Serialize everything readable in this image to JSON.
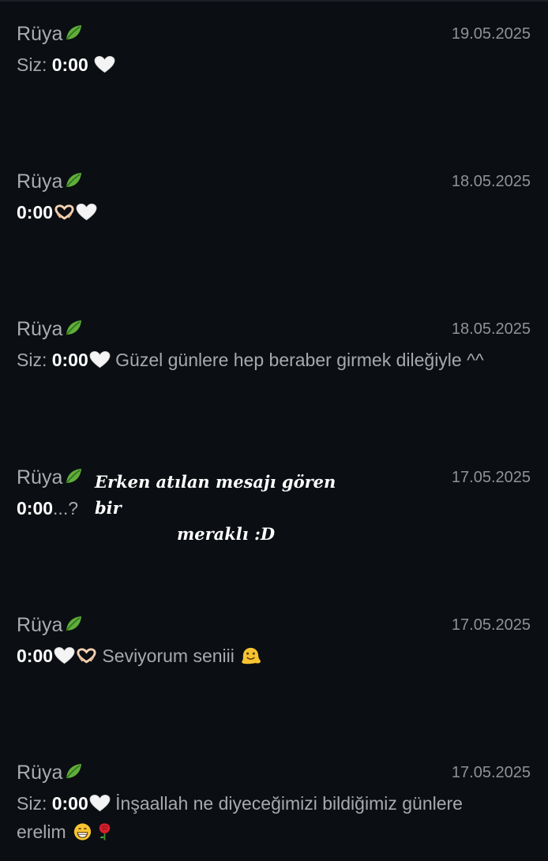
{
  "conversations": [
    {
      "sender": "Rüya",
      "sender_icon": "leaf-icon",
      "date": "19.05.2025",
      "prefix": "Siz: ",
      "time": "0:00",
      "emojis": [
        "white-heart-icon"
      ],
      "text": ""
    },
    {
      "sender": "Rüya",
      "sender_icon": "leaf-icon",
      "date": "18.05.2025",
      "prefix": "",
      "time": "0:00",
      "emojis": [
        "heart-hands-icon",
        "white-heart-icon"
      ],
      "text": ""
    },
    {
      "sender": "Rüya",
      "sender_icon": "leaf-icon",
      "date": "18.05.2025",
      "prefix": "Siz: ",
      "time": "0:00",
      "emojis": [
        "white-heart-icon"
      ],
      "text": " Güzel günlere hep beraber girmek dileğiyle ^^"
    },
    {
      "sender": "Rüya",
      "sender_icon": "leaf-icon",
      "date": "17.05.2025",
      "prefix": "",
      "time": "0:00",
      "emojis": [],
      "text": "...?"
    },
    {
      "sender": "Rüya",
      "sender_icon": "leaf-icon",
      "date": "17.05.2025",
      "prefix": "",
      "time": "0:00",
      "emojis": [
        "white-heart-icon",
        "heart-hands-icon"
      ],
      "text": " Seviyorum seniii",
      "trailing_emojis": [
        "melting-face-icon"
      ]
    },
    {
      "sender": "Rüya",
      "sender_icon": "leaf-icon",
      "date": "17.05.2025",
      "prefix": "Siz: ",
      "time": "0:00",
      "emojis": [
        "white-heart-icon"
      ],
      "text": " İnşaallah ne diyeceğimizi bildiğimiz günlere erelim",
      "trailing_emojis": [
        "grinning-face-icon",
        "rose-icon"
      ]
    }
  ],
  "annotation": {
    "line1": "Erken atılan mesajı gören bir",
    "line2": "meraklı :D"
  }
}
